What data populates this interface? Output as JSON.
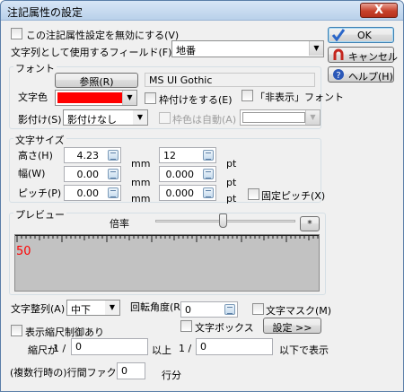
{
  "window": {
    "title": "注記属性の設定",
    "close_label": "X"
  },
  "top": {
    "disable_checkbox_label": "この注記属性設定を無効にする(V)",
    "field_label": "文字列として使用するフィールド(F)",
    "field_select_value": "地番"
  },
  "buttons": {
    "ok": "OK",
    "cancel": "キャンセル",
    "help": "ヘルプ(H)"
  },
  "font": {
    "group_title": "フォント",
    "browse_button": "参照(R)",
    "font_name": "MS UI Gothic",
    "color_label": "文字色",
    "color_value": "#ff0000",
    "frame_checkbox": "枠付けをする(E)",
    "hidden_checkbox": "「非表示」フォント",
    "shadow_label": "影付け(S)",
    "shadow_value": "影付けなし",
    "frame_auto_checkbox": "枠色は自動(A)"
  },
  "size": {
    "group_title": "文字サイズ",
    "height_label": "高さ(H)",
    "height_value": "4.23",
    "width_label": "幅(W)",
    "width_value": "0.00",
    "pitch_label": "ピッチ(P)",
    "pitch_value": "0.00",
    "unit_mm": "mm",
    "pt_height": "12",
    "pt_width": "0.000",
    "pt_pitch": "0.000",
    "unit_pt": "pt",
    "fixed_pitch": "固定ピッチ(X)"
  },
  "preview": {
    "group_title": "プレビュー",
    "scale_label": "倍率",
    "scale_button": "*",
    "sample_text": "50",
    "sample_color": "#ff0000",
    "slider_level": 0.48
  },
  "bottom": {
    "align_label": "文字整列(A)",
    "align_value": "中下",
    "rotation_label": "回転角度(R)",
    "rotation_value": "0",
    "mask_checkbox": "文字マスク(M)",
    "box_checkbox": "文字ボックス",
    "settings_button": "設定 >>",
    "scale_limit_checkbox": "表示縮尺制御あり",
    "scale_text_1": "縮尺が",
    "scale_one_a": "1 /",
    "scale_min": "0",
    "scale_above": "以上",
    "scale_one_b": "1 /",
    "scale_max": "0",
    "scale_below": "以下で表示",
    "line_factor_label": "(複数行時の)行間ファクタ",
    "line_factor_value": "0",
    "line_unit": "行分"
  }
}
